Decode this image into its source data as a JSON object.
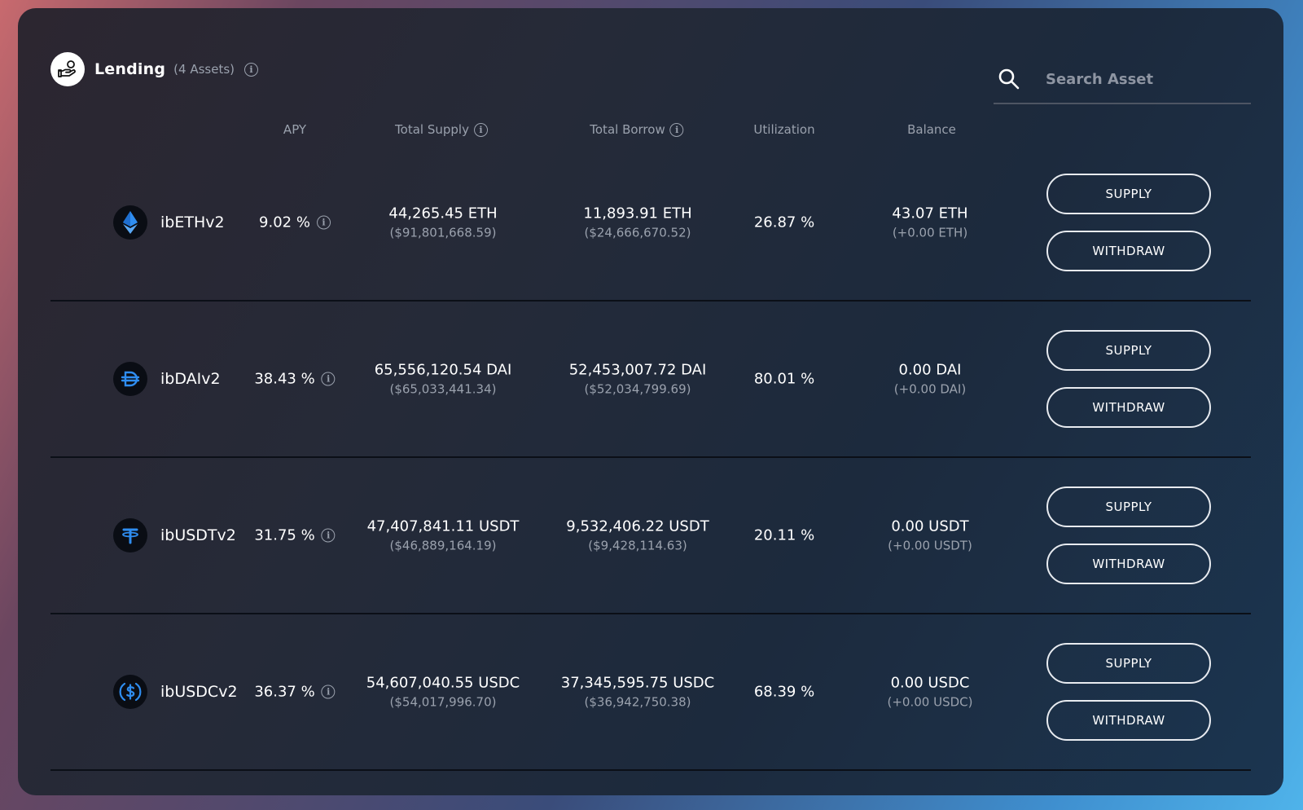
{
  "header": {
    "title": "Lending",
    "count": "(4 Assets)",
    "icon": "hand-coin-icon"
  },
  "search": {
    "placeholder": "Search Asset",
    "value": ""
  },
  "columns": [
    "APY",
    "Total Supply",
    "Total Borrow",
    "Utilization",
    "Balance"
  ],
  "buttons": {
    "supply": "SUPPLY",
    "withdraw": "WITHDRAW"
  },
  "assets": [
    {
      "name": "ibETHv2",
      "icon": "ethereum-icon",
      "icon_color": "#2f8df0",
      "apy": "9.02 %",
      "supply": "44,265.45 ETH",
      "supply_usd": "($91,801,668.59)",
      "borrow": "11,893.91 ETH",
      "borrow_usd": "($24,666,670.52)",
      "utilization": "26.87 %",
      "balance": "43.07 ETH",
      "balance_change": "(+0.00 ETH)"
    },
    {
      "name": "ibDAIv2",
      "icon": "dai-icon",
      "icon_color": "#2f8df0",
      "apy": "38.43 %",
      "supply": "65,556,120.54 DAI",
      "supply_usd": "($65,033,441.34)",
      "borrow": "52,453,007.72 DAI",
      "borrow_usd": "($52,034,799.69)",
      "utilization": "80.01 %",
      "balance": "0.00 DAI",
      "balance_change": "(+0.00 DAI)"
    },
    {
      "name": "ibUSDTv2",
      "icon": "tether-icon",
      "icon_color": "#2f8df0",
      "apy": "31.75 %",
      "supply": "47,407,841.11 USDT",
      "supply_usd": "($46,889,164.19)",
      "borrow": "9,532,406.22 USDT",
      "borrow_usd": "($9,428,114.63)",
      "utilization": "20.11 %",
      "balance": "0.00 USDT",
      "balance_change": "(+0.00 USDT)"
    },
    {
      "name": "ibUSDCv2",
      "icon": "usdc-icon",
      "icon_color": "#2f8df0",
      "apy": "36.37 %",
      "supply": "54,607,040.55 USDC",
      "supply_usd": "($54,017,996.70)",
      "borrow": "37,345,595.75 USDC",
      "borrow_usd": "($36,942,750.38)",
      "utilization": "68.39 %",
      "balance": "0.00 USDC",
      "balance_change": "(+0.00 USDC)"
    }
  ]
}
